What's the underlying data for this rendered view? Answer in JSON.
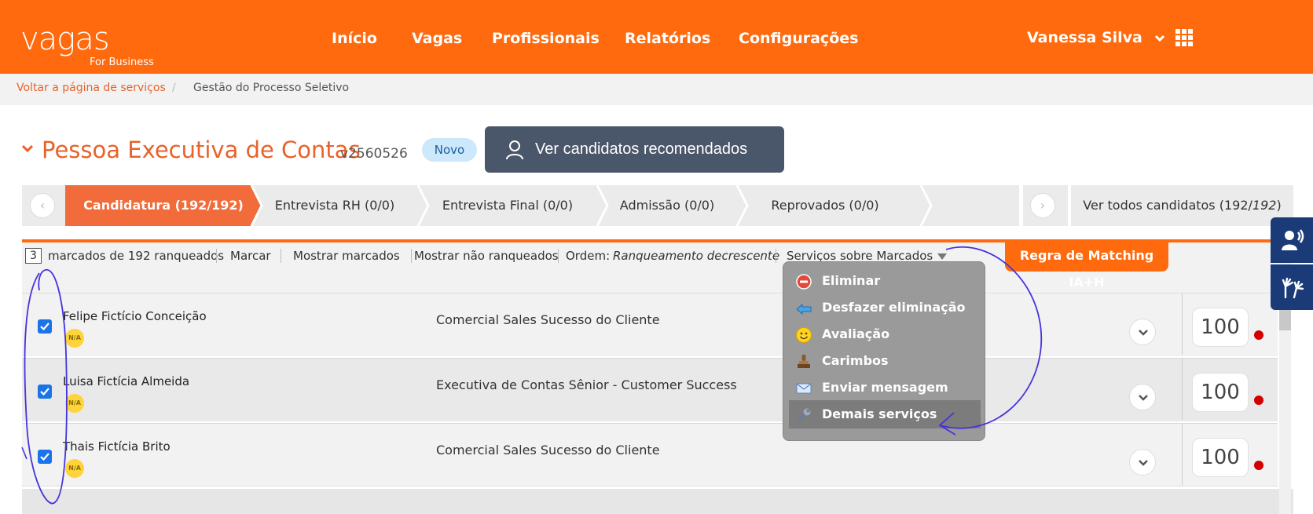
{
  "header": {
    "logo_main": "vagas",
    "logo_sub": "For Business",
    "nav": [
      "Início",
      "Vagas",
      "Profissionais",
      "Relatórios",
      "Configurações"
    ],
    "user_name": "Vanessa Silva",
    "brand_color": "#ff6a0e"
  },
  "breadcrumb": {
    "back_link": "Voltar a página de serviços",
    "separator": "/",
    "current": "Gestão do Processo Seletivo"
  },
  "job": {
    "title": "Pessoa Executiva de Contas",
    "code": "v2560526",
    "status_badge": "Novo",
    "recommended_button": "Ver candidatos recomendados"
  },
  "stages": {
    "items": [
      "Candidatura (192/192)",
      "Entrevista RH (0/0)",
      "Entrevista Final (0/0)",
      "Admissão (0/0)",
      "Reprovados (0/0)",
      ""
    ],
    "active_index": 0,
    "view_all": "Ver todos candidatos (192/",
    "view_all_total": "192",
    "view_all_close": ")"
  },
  "toolbar": {
    "marked_count": "3",
    "marked_text": "marcados de 192 ranqueados",
    "mark": "Marcar",
    "show_marked": "Mostrar marcados",
    "show_unranked": "Mostrar não ranqueados",
    "order_label": "Ordem:",
    "order_value": "Ranqueamento decrescente",
    "services": "Serviços sobre Marcados",
    "matching_button": "Regra de Matching IA+H"
  },
  "candidates": [
    {
      "name": "Felipe Fictício Conceição",
      "position": "Comercial Sales Sucesso do Cliente",
      "badge": "N/A",
      "score": "100",
      "checked": true
    },
    {
      "name": "Luisa Fictícia Almeida",
      "position": "Executiva de Contas Sênior - Customer Success",
      "badge": "N/A",
      "score": "100",
      "checked": true
    },
    {
      "name": "Thais Fictícia Brito",
      "position": "Comercial Sales Sucesso do Cliente",
      "badge": "N/A",
      "score": "100",
      "checked": true
    }
  ],
  "services_menu": {
    "items": [
      {
        "label": "Eliminar",
        "icon": "minus-circle-icon"
      },
      {
        "label": "Desfazer eliminação",
        "icon": "undo-arrow-icon"
      },
      {
        "label": "Avaliação",
        "icon": "smiley-icon"
      },
      {
        "label": "Carimbos",
        "icon": "stamp-icon"
      },
      {
        "label": "Enviar mensagem",
        "icon": "envelope-icon"
      },
      {
        "label": "Demais serviços",
        "icon": "wrench-icon"
      }
    ],
    "highlighted_index": 5
  }
}
